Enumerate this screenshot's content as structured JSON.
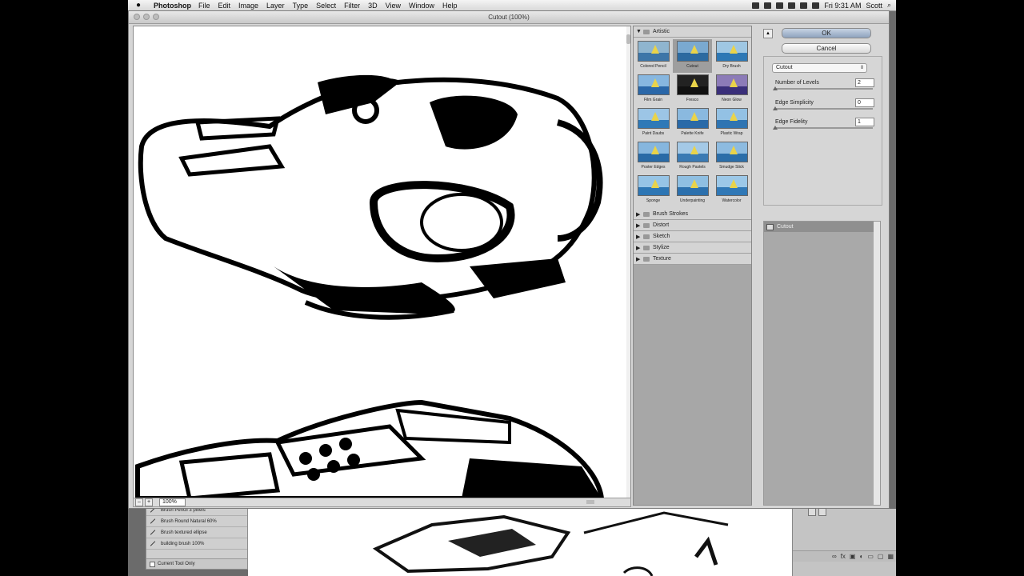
{
  "menubar": {
    "app_name": "Photoshop",
    "menus": [
      "File",
      "Edit",
      "Image",
      "Layer",
      "Type",
      "Select",
      "Filter",
      "3D",
      "View",
      "Window",
      "Help"
    ],
    "clock": "Fri 9:31 AM",
    "user": "Scott"
  },
  "dialog": {
    "title": "Cutout (100%)",
    "zoom": "100%"
  },
  "gallery": {
    "open_category": "Artistic",
    "filters": [
      {
        "label": "Colored Pencil",
        "selected": false
      },
      {
        "label": "Cutout",
        "selected": true
      },
      {
        "label": "Dry Brush",
        "selected": false
      },
      {
        "label": "Film Grain",
        "selected": false
      },
      {
        "label": "Fresco",
        "selected": false
      },
      {
        "label": "Neon Glow",
        "selected": false
      },
      {
        "label": "Paint Daubs",
        "selected": false
      },
      {
        "label": "Palette Knife",
        "selected": false
      },
      {
        "label": "Plastic Wrap",
        "selected": false
      },
      {
        "label": "Poster Edges",
        "selected": false
      },
      {
        "label": "Rough Pastels",
        "selected": false
      },
      {
        "label": "Smudge Stick",
        "selected": false
      },
      {
        "label": "Sponge",
        "selected": false
      },
      {
        "label": "Underpainting",
        "selected": false
      },
      {
        "label": "Watercolor",
        "selected": false
      }
    ],
    "other_categories": [
      "Brush Strokes",
      "Distort",
      "Sketch",
      "Stylize",
      "Texture"
    ]
  },
  "settings": {
    "ok_label": "OK",
    "cancel_label": "Cancel",
    "filter_select": "Cutout",
    "params": [
      {
        "label": "Number of Levels",
        "value": "2"
      },
      {
        "label": "Edge Simplicity",
        "value": "0"
      },
      {
        "label": "Edge Fidelity",
        "value": "1"
      }
    ],
    "effect_layer": "Cutout"
  },
  "presets_panel": {
    "items": [
      "Brush Pencil 3 pixels",
      "Brush Round Natural 60%",
      "Brush textured ellipse",
      "building brush 100%"
    ],
    "footer": "Current Tool Only"
  }
}
